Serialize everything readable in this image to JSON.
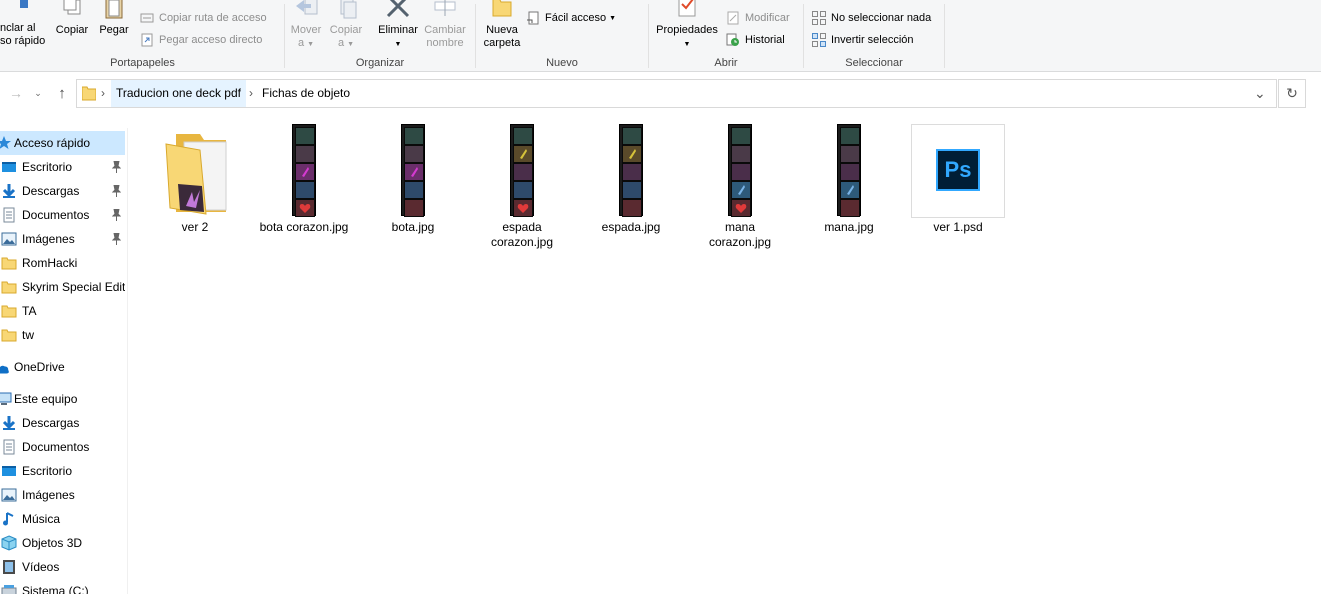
{
  "ribbon": {
    "portapapeles": {
      "anclar_line1": "nclar al",
      "anclar_line2": "so rápido",
      "copiar": "Copiar",
      "pegar": "Pegar",
      "copiar_ruta": "Copiar ruta de acceso",
      "pegar_acceso": "Pegar acceso directo",
      "label": "Portapapeles"
    },
    "organizar": {
      "mover_line1": "Mover",
      "mover_line2": "a",
      "copiar_line1": "Copiar",
      "copiar_line2": "a",
      "eliminar": "Eliminar",
      "cambiar_line1": "Cambiar",
      "cambiar_line2": "nombre",
      "label": "Organizar"
    },
    "nuevo": {
      "nueva_line1": "Nueva",
      "nueva_line2": "carpeta",
      "facil_acceso": "Fácil acceso",
      "label": "Nuevo"
    },
    "abrir": {
      "propiedades": "Propiedades",
      "modificar": "Modificar",
      "historial": "Historial",
      "label": "Abrir"
    },
    "seleccionar": {
      "no_seleccionar": "No seleccionar nada",
      "invertir": "Invertir selección",
      "label": "Seleccionar"
    }
  },
  "address": {
    "crumbs": [
      "Traducion one deck pdf",
      "Fichas de objeto"
    ]
  },
  "navpane": {
    "quick_access": "Acceso rápido",
    "quick_items": [
      "Escritorio",
      "Descargas",
      "Documentos",
      "Imágenes",
      "RomHacki",
      "Skyrim Special Editi",
      "TA",
      "tw"
    ],
    "onedrive": "OneDrive",
    "this_pc": "Este equipo",
    "pc_items": [
      "Descargas",
      "Documentos",
      "Escritorio",
      "Imágenes",
      "Música",
      "Objetos 3D",
      "Vídeos",
      "Sistema (C:)"
    ]
  },
  "files": [
    {
      "line1": "ver 2",
      "line2": ""
    },
    {
      "line1": "bota corazon.jpg",
      "line2": ""
    },
    {
      "line1": "bota.jpg",
      "line2": ""
    },
    {
      "line1": "espada",
      "line2": "corazon.jpg"
    },
    {
      "line1": "espada.jpg",
      "line2": ""
    },
    {
      "line1": "mana",
      "line2": "corazon.jpg"
    },
    {
      "line1": "mana.jpg",
      "line2": ""
    },
    {
      "line1": "ver 1.psd",
      "line2": ""
    }
  ],
  "ps_logo": "Ps",
  "colors": {
    "selection": "#cce8ff",
    "folder": "#f8d775",
    "accent": "#0078d7",
    "ps_blue": "#31a8ff",
    "ps_bg": "#001e36"
  }
}
